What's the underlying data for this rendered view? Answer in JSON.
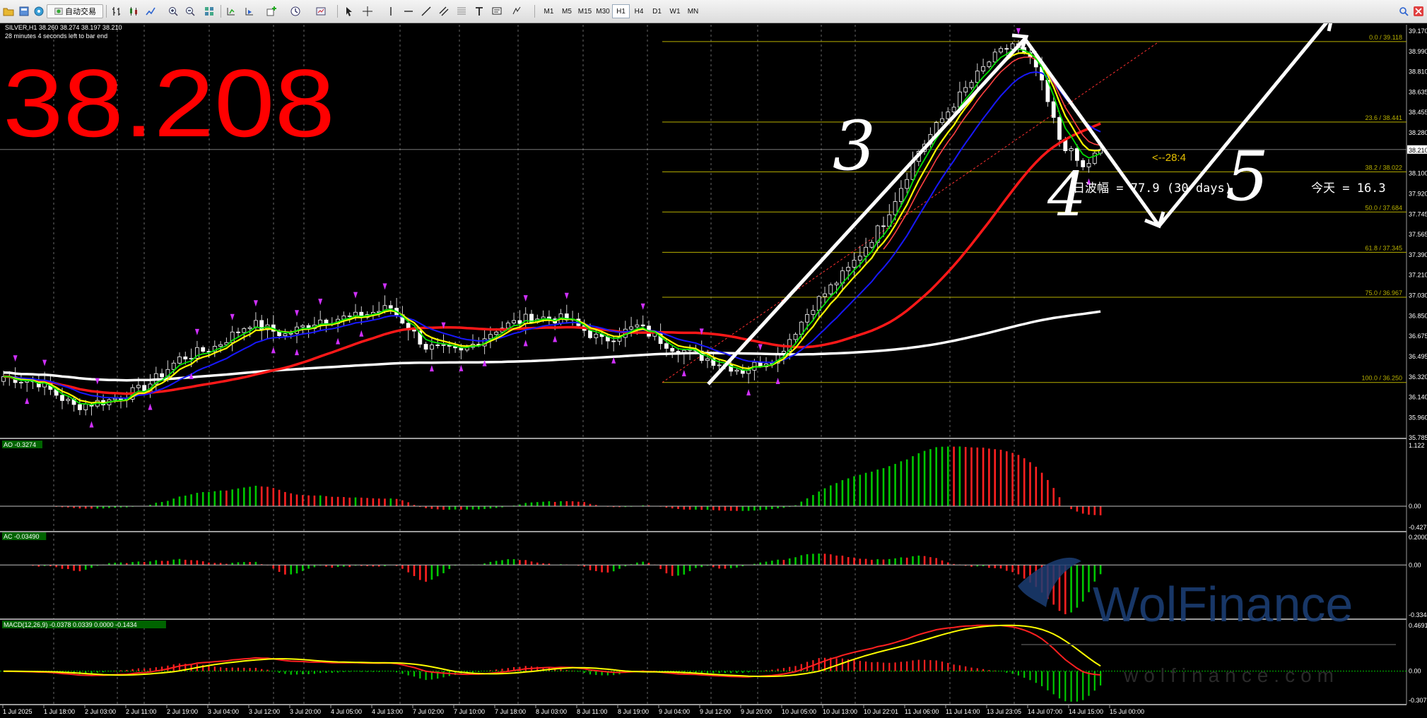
{
  "toolbar": {
    "autotrade_label": "自动交易",
    "timeframes": [
      "M1",
      "M5",
      "M15",
      "M30",
      "H1",
      "H4",
      "D1",
      "W1",
      "MN"
    ],
    "active_timeframe": "H1",
    "icons_left": [
      "folder-icon",
      "profiles-icon",
      "market-watch-icon",
      "navigator-icon"
    ],
    "icons_tools": [
      "bar-chart-icon",
      "candles-icon",
      "line-chart-icon",
      "zoom-in-icon",
      "zoom-out-icon",
      "tile-icon",
      "autoscroll-icon",
      "chart-shift-icon",
      "indicators-icon",
      "periods-icon",
      "templates-icon",
      "cursor-icon",
      "crosshair-icon",
      "vline-icon",
      "hline-icon",
      "trendline-icon",
      "channel-icon",
      "fibo-icon",
      "text-icon",
      "label-icon"
    ]
  },
  "chart_header": {
    "symbol_line": "SILVER,H1  38.260 38.274 38.197 38.210",
    "timer_line": "28 minutes 4 seconds left to bar end"
  },
  "big_price": "38.208",
  "colors": {
    "bull": "#00c800",
    "bear": "#ff2020",
    "ma_yellow": "#ffff00",
    "ma_green": "#00e000",
    "ma_blue": "#1818ff",
    "ma_red": "#ff1818",
    "ma_white": "#ffffff",
    "fib": "#b8b000",
    "grid": "#c0c0c0",
    "big_price": "#ff0000"
  },
  "annotations": {
    "wave_3": "3",
    "wave_4": "4",
    "wave_5": "5",
    "countdown": "<--28:4",
    "amplitude_label": "日波幅 = 77.9  (30 days)",
    "today_label": "今天 = 16.3"
  },
  "watermark": {
    "brand": "WolFinance",
    "url": "wolfinance.com"
  },
  "chart_data": [
    {
      "type": "candlestick",
      "name": "SILVER,H1",
      "ylim": [
        35.785,
        39.26
      ],
      "y_ticks": [
        "39.170",
        "38.990",
        "38.810",
        "38.635",
        "38.455",
        "38.280",
        "38.210",
        "38.100",
        "37.920",
        "37.745",
        "37.565",
        "37.390",
        "37.210",
        "37.030",
        "36.850",
        "36.675",
        "36.495",
        "36.320",
        "36.140",
        "35.960",
        "35.785"
      ],
      "current_price": 38.21,
      "x_ticks": [
        "1 Jul 2025",
        "1 Jul 18:00",
        "2 Jul 03:00",
        "2 Jul 11:00",
        "2 Jul 19:00",
        "3 Jul 04:00",
        "3 Jul 12:00",
        "3 Jul 20:00",
        "4 Jul 05:00",
        "4 Jul 13:00",
        "7 Jul 02:00",
        "7 Jul 10:00",
        "7 Jul 18:00",
        "8 Jul 03:00",
        "8 Jul 11:00",
        "8 Jul 19:00",
        "9 Jul 04:00",
        "9 Jul 12:00",
        "9 Jul 20:00",
        "10 Jul 05:00",
        "10 Jul 13:00",
        "10 Jul 22:01",
        "11 Jul 06:00",
        "11 Jul 14:00",
        "13 Jul 23:05",
        "14 Jul 07:00",
        "14 Jul 15:00",
        "15 Jul 00:00"
      ],
      "close_anchors": [
        [
          0,
          36.3
        ],
        [
          6,
          36.25
        ],
        [
          12,
          36.05
        ],
        [
          18,
          36.1
        ],
        [
          24,
          36.2
        ],
        [
          30,
          36.45
        ],
        [
          36,
          36.55
        ],
        [
          42,
          36.75
        ],
        [
          48,
          36.65
        ],
        [
          54,
          36.78
        ],
        [
          60,
          36.8
        ],
        [
          66,
          36.88
        ],
        [
          72,
          36.55
        ],
        [
          78,
          36.5
        ],
        [
          84,
          36.7
        ],
        [
          90,
          36.8
        ],
        [
          96,
          36.78
        ],
        [
          102,
          36.6
        ],
        [
          108,
          36.72
        ],
        [
          114,
          36.55
        ],
        [
          120,
          36.45
        ],
        [
          126,
          36.35
        ],
        [
          132,
          36.48
        ],
        [
          138,
          36.9
        ],
        [
          144,
          37.2
        ],
        [
          150,
          37.6
        ],
        [
          156,
          38.2
        ],
        [
          162,
          38.6
        ],
        [
          168,
          38.95
        ],
        [
          172,
          39.1
        ],
        [
          176,
          38.9
        ],
        [
          180,
          38.3
        ],
        [
          184,
          38.05
        ],
        [
          187,
          38.21
        ]
      ],
      "fibonacci": {
        "levels": [
          {
            "label": "0.0 / 39.118",
            "value": 39.118
          },
          {
            "label": "23.6 / 38.441",
            "value": 38.441
          },
          {
            "label": "38.2 / 38.022",
            "value": 38.022
          },
          {
            "label": "50.0 / 37.684",
            "value": 37.684
          },
          {
            "label": "61.8 / 37.345",
            "value": 37.345
          },
          {
            "label": "75.0 / 36.967",
            "value": 36.967
          },
          {
            "label": "100.0 / 36.250",
            "value": 36.25
          }
        ]
      },
      "moving_averages": [
        "yellow",
        "green",
        "blue",
        "red",
        "white"
      ]
    },
    {
      "type": "bar",
      "name": "AO -0.3274",
      "ylim": [
        -0.4275,
        1.122
      ],
      "y_ticks": [
        "1.122",
        "0.00",
        "-0.4275"
      ]
    },
    {
      "type": "bar",
      "name": "AC -0.03490",
      "ylim": [
        -0.3344,
        0.2
      ],
      "y_ticks": [
        "0.2000",
        "0.00",
        "-0.3344"
      ]
    },
    {
      "type": "line",
      "name": "MACD(12,26,9) -0.0378 0.0339 0.0000 -0.1434",
      "ylim": [
        -0.3076,
        0.4691
      ],
      "y_ticks": [
        "0.4691",
        "0.00",
        "-0.3076"
      ]
    }
  ]
}
